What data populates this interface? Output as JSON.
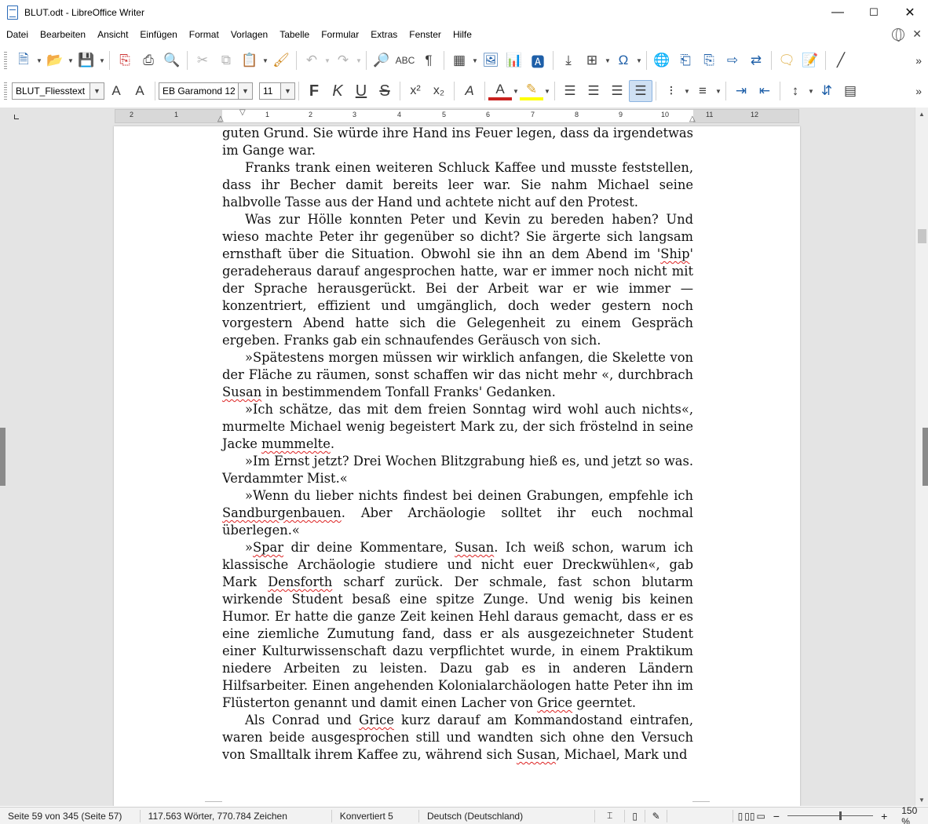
{
  "window": {
    "title": "BLUT.odt - LibreOffice Writer",
    "min": "—",
    "max": "☐",
    "close": "✕"
  },
  "menu": [
    "Datei",
    "Bearbeiten",
    "Ansicht",
    "Einfügen",
    "Format",
    "Vorlagen",
    "Tabelle",
    "Formular",
    "Extras",
    "Fenster",
    "Hilfe"
  ],
  "format_toolbar": {
    "paragraph_style": "BLUT_Fliesstext",
    "font_name": "EB Garamond 12",
    "font_size": "11",
    "bold": "F",
    "italic": "K",
    "underline": "U",
    "strike": "S"
  },
  "ruler": {
    "numbers": [
      "2",
      "1",
      "1",
      "2",
      "3",
      "4",
      "5",
      "6",
      "7",
      "8",
      "9",
      "10",
      "11",
      "12"
    ]
  },
  "document": {
    "paragraphs": [
      {
        "cont": true,
        "segments": [
          {
            "t": "guten Grund. Sie würde ihre Hand ins Feuer legen, dass da irgendetwas im Gange war."
          }
        ]
      },
      {
        "segments": [
          {
            "t": "Franks trank einen weiteren Schluck Kaffee und musste feststellen, dass ihr Becher damit bereits leer war. Sie nahm Michael seine halbvolle Tasse aus der Hand und achtete nicht auf den Protest."
          }
        ]
      },
      {
        "segments": [
          {
            "t": "Was zur Hölle konnten Peter und Kevin zu bereden haben? Und wieso machte Peter ihr gegenüber so dicht? Sie ärgerte sich langsam ernsthaft über die Situation. Obwohl sie ihn an dem Abend im '"
          },
          {
            "t": "Ship",
            "sp": true
          },
          {
            "t": "' geradeheraus darauf angesprochen hatte, war er immer noch nicht mit der Sprache herausgerückt. Bei der Arbeit war er wie immer — konzentriert, effizient und umgänglich, doch weder gestern noch vorgestern Abend hatte sich die Gelegenheit zu einem Gespräch ergeben. Franks gab ein schnaufendes Geräusch von sich."
          }
        ]
      },
      {
        "segments": [
          {
            "t": "»Spätestens morgen müssen wir wirklich anfangen, die Skelette von der Fläche zu räumen, sonst schaffen wir das nicht mehr «, durchbrach "
          },
          {
            "t": "Susan",
            "sp": true
          },
          {
            "t": " in bestimmendem Tonfall Franks' Gedanken."
          }
        ]
      },
      {
        "segments": [
          {
            "t": "»Ich schätze, das mit dem freien Sonntag wird wohl auch nichts«, murmelte Michael wenig begeistert Mark zu, der sich fröstelnd in seine Jacke "
          },
          {
            "t": "mummelte",
            "sp": true
          },
          {
            "t": "."
          }
        ]
      },
      {
        "segments": [
          {
            "t": "»Im Ernst jetzt? Drei Wochen Blitzgrabung hieß es, und jetzt so was. Verdammter Mist.«"
          }
        ]
      },
      {
        "segments": [
          {
            "t": "»Wenn du lieber nichts findest bei deinen Grabungen, empfehle ich "
          },
          {
            "t": "Sandburgenbauen",
            "sp": true
          },
          {
            "t": ". Aber Archäologie solltet ihr euch nochmal überlegen.«"
          }
        ]
      },
      {
        "segments": [
          {
            "t": "»"
          },
          {
            "t": "Spar",
            "sp": true
          },
          {
            "t": " dir deine Kommentare, "
          },
          {
            "t": "Susan",
            "sp": true
          },
          {
            "t": ". Ich weiß schon, warum ich klassische Archäologie studiere und nicht euer Dreckwühlen«, gab Mark "
          },
          {
            "t": "Densforth",
            "sp": true
          },
          {
            "t": " scharf zurück. Der schmale, fast schon blutarm wirkende Student besaß eine spitze Zunge. Und wenig bis keinen Humor. Er hatte die ganze Zeit keinen Hehl daraus gemacht, dass er es eine ziemliche Zumutung fand, dass er als ausgezeichneter Student einer Kulturwissenschaft dazu verpflichtet wurde, in einem Praktikum niedere Arbeiten zu leisten. Dazu gab es in anderen Ländern Hilfsarbeiter. Einen angehenden Kolonialarchäologen hatte Peter ihn im Flüsterton genannt und damit einen Lacher von "
          },
          {
            "t": "Grice",
            "sp": true
          },
          {
            "t": " geerntet."
          }
        ]
      },
      {
        "segments": [
          {
            "t": "Als Conrad und "
          },
          {
            "t": "Grice",
            "sp": true
          },
          {
            "t": " kurz darauf am Kommandostand eintrafen, waren beide ausgesprochen still und wandten sich ohne den Versuch von Smalltalk ihrem Kaffee zu, während sich "
          },
          {
            "t": "Susan",
            "sp": true
          },
          {
            "t": ", Michael, Mark und"
          }
        ]
      }
    ]
  },
  "status": {
    "page": "Seite 59 von 345 (Seite 57)",
    "words": "117.563 Wörter, 770.784 Zeichen",
    "track": "Konvertiert 5",
    "language": "Deutsch (Deutschland)",
    "zoom_minus": "−",
    "zoom_plus": "+",
    "zoom": "150 %"
  }
}
